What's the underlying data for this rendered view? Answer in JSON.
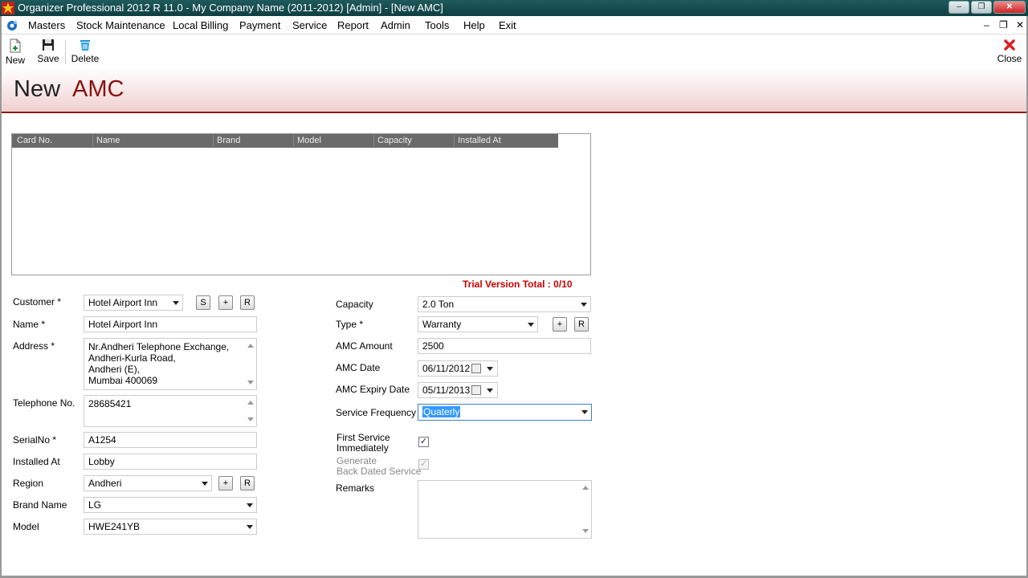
{
  "window": {
    "title": "Organizer Professional 2012 R 11.0 - My Company Name (2011-2012)  [Admin] - [New AMC]",
    "minimize": "‒",
    "maximize": "❐",
    "close": "✕"
  },
  "menu": {
    "items": [
      "Masters",
      "Stock Maintenance",
      "Local Billing",
      "Payment",
      "Service",
      "Report",
      "Admin",
      "Tools",
      "Help",
      "Exit"
    ],
    "mdi_min": "–",
    "mdi_restore": "❐",
    "mdi_close": "✕"
  },
  "toolbar": {
    "new": "New",
    "save": "Save",
    "delete": "Delete",
    "close": "Close"
  },
  "banner": {
    "word1": "New",
    "word2": "AMC"
  },
  "grid": {
    "columns": [
      "Card No.",
      "Name",
      "Brand",
      "Model",
      "Capacity",
      "Installed At"
    ],
    "rows": []
  },
  "trial": "Trial Version Total : 0/10",
  "left_form": {
    "customer_label": "Customer *",
    "customer_value": "Hotel Airport Inn",
    "btn_s": "S",
    "btn_add": "+",
    "btn_r": "R",
    "name_label": "Name *",
    "name_value": "Hotel Airport Inn",
    "address_label": "Address *",
    "address_lines": [
      "Nr.Andheri Telephone Exchange,",
      "Andheri-Kurla Road,",
      "Andheri (E),",
      "Mumbai 400069"
    ],
    "telephone_label": "Telephone No.",
    "telephone_value": "28685421",
    "serial_label": "SerialNo *",
    "serial_value": "A1254",
    "installed_label": "Installed At",
    "installed_value": "Lobby",
    "region_label": "Region",
    "region_value": "Andheri",
    "brand_label": "Brand Name",
    "brand_value": "LG",
    "model_label": "Model",
    "model_value": "HWE241YB"
  },
  "right_form": {
    "capacity_label": "Capacity",
    "capacity_value": "2.0 Ton",
    "type_label": "Type *",
    "type_value": "Warranty",
    "amount_label": "AMC Amount",
    "amount_value": "2500",
    "date_label": "AMC Date",
    "date_value": "06/11/2012",
    "expiry_label": "AMC Expiry Date",
    "expiry_value": "05/11/2013",
    "freq_label": "Service Frequency *",
    "freq_value": "Quaterly",
    "first_service_label_1": "First Service",
    "first_service_label_2": "Immediately",
    "first_service_checked": "✓",
    "backdated_label_1": "Generate",
    "backdated_label_2": "Back Dated Service",
    "backdated_checked": "✓",
    "remarks_label": "Remarks",
    "remarks_value": ""
  }
}
